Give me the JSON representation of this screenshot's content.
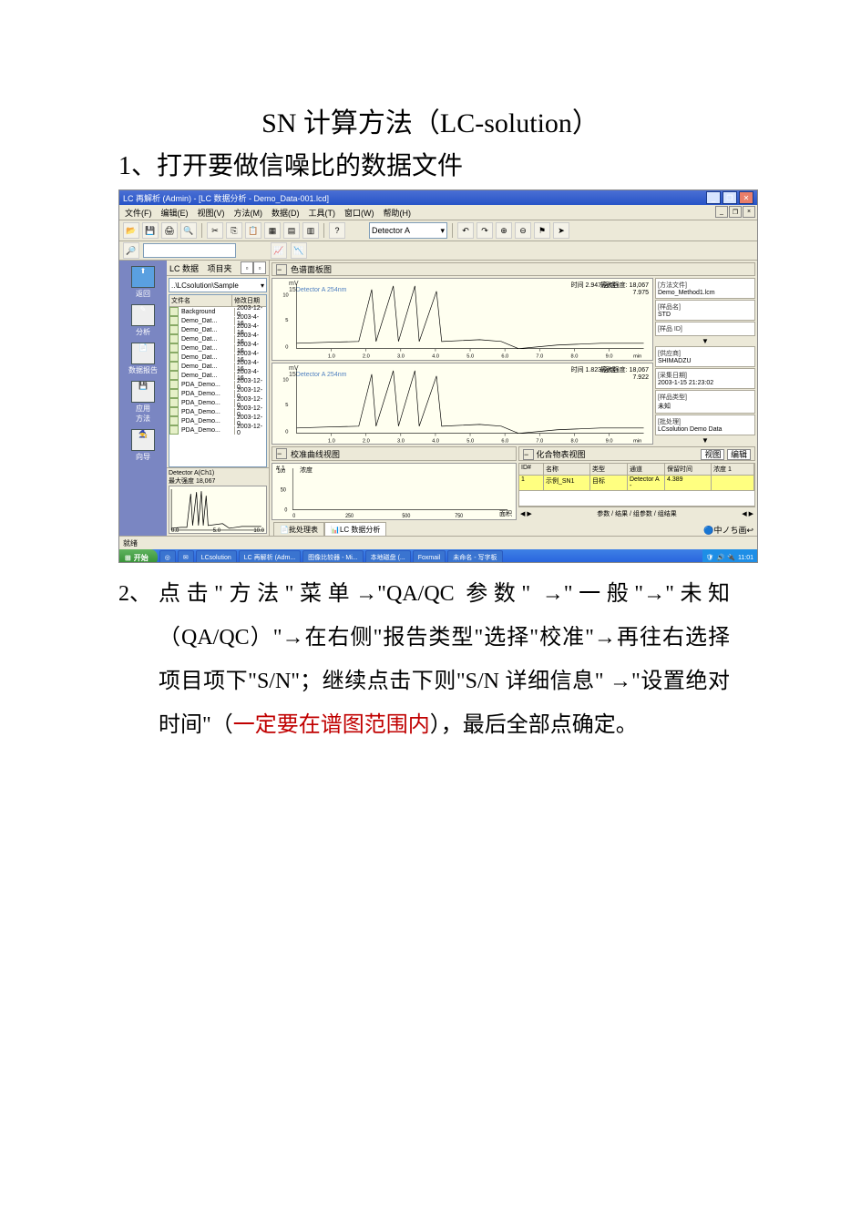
{
  "doc": {
    "title": "SN 计算方法（LC-solution）",
    "step1": "1、打开要做信噪比的数据文件",
    "step2_num": "2、",
    "step2_a": "点击\"方法\"菜单→\"",
    "step2_qaqc": "QA/QC 参数",
    "step2_b": "\" →\"一般\"→\"未知（QA/QC）\"→在右侧\"报告类型\"选择\"校准\"→再往右选择项目项下\"S/N\"；继续点击下则\"S/N 详细信息\" →\"设置绝对时间\"（",
    "step2_red": "一定要在谱图范围内",
    "step2_c": "），最后全部点确定。"
  },
  "app": {
    "titlebar": "LC 再解析 (Admin) - [LC 数据分析 - Demo_Data-001.lcd]",
    "menus": [
      "文件(F)",
      "编辑(E)",
      "视图(V)",
      "方法(M)",
      "数据(D)",
      "工具(T)",
      "窗口(W)",
      "帮助(H)"
    ],
    "detector": "Detector A",
    "explorer_label": "LC 数据",
    "explorer_tab": "项目夹",
    "path": "..\\LCsolution\\Sample",
    "file_cols": [
      "文件名",
      "修改日期"
    ],
    "files": [
      {
        "name": "Background",
        "date": "2003-12-0"
      },
      {
        "name": "Demo_Dat...",
        "date": "2003-4-16"
      },
      {
        "name": "Demo_Dat...",
        "date": "2003-4-16"
      },
      {
        "name": "Demo_Dat...",
        "date": "2003-4-16"
      },
      {
        "name": "Demo_Dat...",
        "date": "2003-4-16"
      },
      {
        "name": "Demo_Dat...",
        "date": "2003-4-16"
      },
      {
        "name": "Demo_Dat...",
        "date": "2003-4-16"
      },
      {
        "name": "Demo_Dat...",
        "date": "2003-4-16"
      },
      {
        "name": "PDA_Demo...",
        "date": "2003-12-0"
      },
      {
        "name": "PDA_Demo...",
        "date": "2003-12-0"
      },
      {
        "name": "PDA_Demo...",
        "date": "2003-12-0"
      },
      {
        "name": "PDA_Demo...",
        "date": "2003-12-0"
      },
      {
        "name": "PDA_Demo...",
        "date": "2003-12-0"
      },
      {
        "name": "PDA_Demo...",
        "date": "2003-12-0"
      }
    ],
    "thumb_label": "Detector A(Ch1)",
    "thumb_max": "最大强度  18,067",
    "nav": [
      {
        "label": "返回"
      },
      {
        "label": "分析"
      },
      {
        "label": "数据报告"
      },
      {
        "label": "应用\n方法"
      },
      {
        "label": "向导"
      }
    ],
    "pane_chrom": "色谱面板图",
    "pane_calib": "校准曲线视图",
    "pane_table": "化合物表视图",
    "chart_ylabel": "Detector A 254nm",
    "chart_unit": "mV",
    "rt_text1": "时间   2.947   强度",
    "rt_text2": "时间   1.823   强度",
    "max1": "最大强度: 18,067",
    "ratio1": "7.975",
    "max2": "最大强度: 18,067",
    "ratio2": "7.922",
    "info": {
      "method_k": "[方法文件]",
      "method_v": "Demo_Method1.lcm",
      "sample_k": "[样品名]",
      "sample_v": "STD",
      "sid_k": "[样品 ID]",
      "sid_v": "",
      "vendor_k": "[供应商]",
      "vendor_v": "SHIMADZU",
      "acq_k": "[采集日期]",
      "acq_v": "2003-1-15 21:23:02",
      "type_k": "[样品类型]",
      "type_v": "未知",
      "batch_k": "[批处理]",
      "batch_v": "LCsolution Demo Data"
    },
    "table_cols": [
      "ID#",
      "名称",
      "类型",
      "通道",
      "保留时间",
      "浓度 1"
    ],
    "table_row": [
      "1",
      "示例_SN1",
      "目标",
      "",
      "Detector A -",
      "4.389",
      ""
    ],
    "calib_label": "面积",
    "bottom_tabs": [
      "批处理表",
      "LC 数据分析"
    ],
    "view_tabs_right": "参数 / 结果 / 组参数 / 组结果",
    "edit_btn": "编辑",
    "view_btn": "视图",
    "status": "就绪",
    "taskbar": {
      "start": "开始",
      "items": [
        "LCsolution",
        "LC 再解析 (Adm...",
        "图像比较器 - Mi...",
        "本地磁盘 (...",
        "Foxmail",
        "未命名 - 写字板"
      ],
      "clock": "11:01"
    }
  },
  "chart_data": [
    {
      "type": "line",
      "title": "Detector A 254nm",
      "xlabel": "min",
      "ylabel": "mV",
      "xlim": [
        0,
        10
      ],
      "ylim": [
        0,
        16
      ],
      "xticks": [
        1,
        2,
        3,
        4,
        5,
        6,
        7,
        8,
        9
      ],
      "yticks": [
        0,
        5,
        10,
        15
      ],
      "peaks_rt": [
        2.6,
        3.3,
        3.9,
        4.4
      ],
      "baseline_bump": {
        "from": 5.5,
        "to": 8.0,
        "drop": -1.2
      },
      "max_intensity": 18067
    },
    {
      "type": "line",
      "title": "Detector A 254nm",
      "xlabel": "min",
      "ylabel": "mV",
      "xlim": [
        0,
        10
      ],
      "ylim": [
        0,
        16
      ],
      "xticks": [
        1,
        2,
        3,
        4,
        5,
        6,
        7,
        8,
        9
      ],
      "yticks": [
        0,
        5,
        10,
        15
      ],
      "peaks_rt": [
        2.6,
        3.3,
        3.9,
        4.4
      ],
      "baseline_bump": {
        "from": 5.5,
        "to": 8.0,
        "drop": -1.2
      },
      "max_intensity": 18067
    },
    {
      "type": "line",
      "title": "校准曲线",
      "xlabel": "面积",
      "ylabel": "",
      "xlim": [
        0,
        1000
      ],
      "ylim": [
        0,
        100
      ],
      "xticks": [
        0,
        250,
        500,
        750
      ],
      "yticks": [
        0,
        50,
        100
      ],
      "series": []
    }
  ]
}
